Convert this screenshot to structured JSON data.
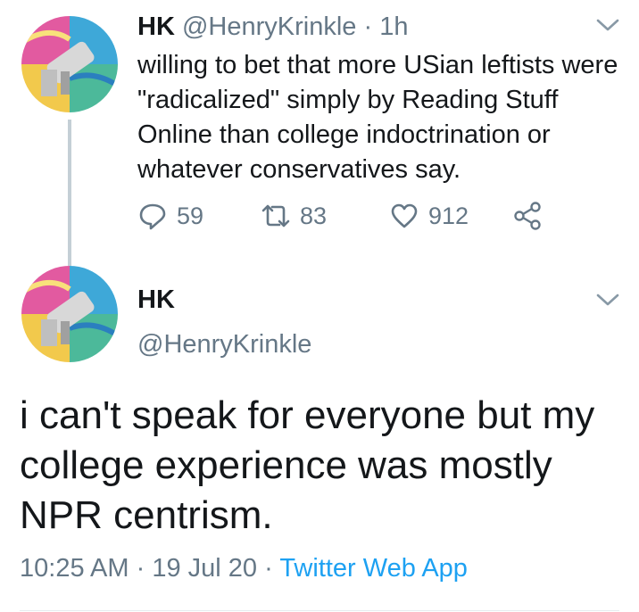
{
  "tweet1": {
    "name": "HK",
    "handle": "@HenryKrinkle",
    "separator": "·",
    "time": "1h",
    "text": "willing to bet that more USian leftists were \"radicalized\" simply by Reading Stuff Online than college indoctrination or whatever conservatives say.",
    "actions": {
      "reply_count": "59",
      "retweet_count": "83",
      "like_count": "912"
    }
  },
  "tweet2": {
    "name": "HK",
    "handle": "@HenryKrinkle",
    "text": "i can't speak for everyone but my college experience was mostly NPR centrism.",
    "time": "10:25 AM",
    "dot1": "·",
    "date": "19 Jul 20",
    "dot2": "·",
    "source": "Twitter Web App"
  },
  "icons": {
    "reply": "reply-icon",
    "retweet": "retweet-icon",
    "like": "heart-icon",
    "share": "share-icon",
    "more": "chevron-down-icon"
  },
  "colors": {
    "text": "#14171a",
    "muted": "#657786",
    "link": "#1da1f2",
    "thread_line": "#c4cfd6"
  }
}
